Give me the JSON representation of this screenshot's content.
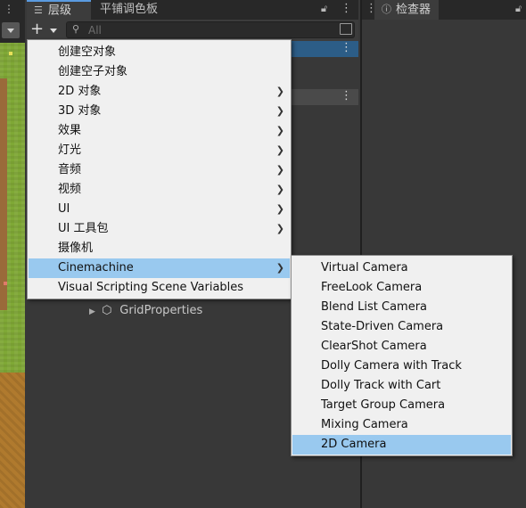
{
  "hierarchy": {
    "tab_label": "层级",
    "palette_tab_label": "平铺调色板",
    "search_placeholder": "All",
    "grid_properties_label": "GridProperties"
  },
  "inspector": {
    "tab_label": "检查器"
  },
  "context_menu": {
    "items": [
      {
        "label": "创建空对象",
        "submenu": false
      },
      {
        "label": "创建空子对象",
        "submenu": false
      },
      {
        "label": "2D 对象",
        "submenu": true
      },
      {
        "label": "3D 对象",
        "submenu": true
      },
      {
        "label": "效果",
        "submenu": true
      },
      {
        "label": "灯光",
        "submenu": true
      },
      {
        "label": "音频",
        "submenu": true
      },
      {
        "label": "视频",
        "submenu": true
      },
      {
        "label": "UI",
        "submenu": true
      },
      {
        "label": "UI 工具包",
        "submenu": true
      },
      {
        "label": "摄像机",
        "submenu": false
      },
      {
        "label": "Cinemachine",
        "submenu": true,
        "highlighted": true
      },
      {
        "label": "Visual Scripting Scene Variables",
        "submenu": false
      }
    ]
  },
  "cinemachine_submenu": {
    "items": [
      {
        "label": "Virtual Camera"
      },
      {
        "label": "FreeLook Camera"
      },
      {
        "label": "Blend List Camera"
      },
      {
        "label": "State-Driven Camera"
      },
      {
        "label": "ClearShot Camera"
      },
      {
        "label": "Dolly Camera with Track"
      },
      {
        "label": "Dolly Track with Cart"
      },
      {
        "label": "Target Group Camera"
      },
      {
        "label": "Mixing Camera"
      },
      {
        "label": "2D Camera",
        "highlighted": true
      }
    ]
  },
  "colors": {
    "menu_highlight": "#99c9ef",
    "selected_row": "#2c5d87",
    "panel_bg": "#383838"
  },
  "icons": [
    "hierarchy-icon",
    "lock-icon",
    "menu-dots-icon",
    "plus-icon",
    "search-icon",
    "filter-icon",
    "submenu-arrow-icon",
    "gameobject-cube-icon",
    "expand-triangle-icon"
  ]
}
